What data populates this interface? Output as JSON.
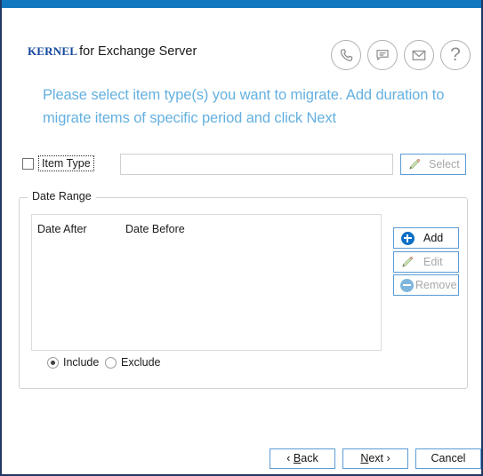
{
  "window": {
    "titlebar_color": "#1178bf",
    "border_color": "#1f3864"
  },
  "header": {
    "brand_mark": "Kernel",
    "brand_suffix": "for Exchange Server",
    "brand_color": "#15489e",
    "icons": [
      {
        "name": "phone-icon",
        "title": "Call support"
      },
      {
        "name": "chat-icon",
        "title": "Live chat"
      },
      {
        "name": "email-icon",
        "title": "Email support"
      },
      {
        "name": "help-icon",
        "title": "Help",
        "glyph": "?"
      }
    ]
  },
  "main": {
    "heading": "Please select item type(s) you want to migrate. Add duration to migrate items of specific period and click Next",
    "heading_color": "#64b0e0",
    "item_type": {
      "checkbox_label": "Item Type",
      "checked": false,
      "input_value": "",
      "input_placeholder": "",
      "select_button": {
        "label": "Select",
        "icon": "pencil-icon",
        "enabled": false
      }
    },
    "date_range": {
      "group_title": "Date Range",
      "columns": [
        "Date After",
        "Date Before"
      ],
      "rows": [],
      "buttons": [
        {
          "name": "add",
          "label": "Add",
          "icon": "circle-plus-icon",
          "enabled": true
        },
        {
          "name": "edit",
          "label": "Edit",
          "icon": "pencil-icon",
          "enabled": false
        },
        {
          "name": "remove",
          "label": "Remove",
          "icon": "circle-minus-icon",
          "enabled": false
        }
      ],
      "scope_options": [
        {
          "value": "include",
          "label": "Include",
          "selected": true
        },
        {
          "value": "exclude",
          "label": "Exclude",
          "selected": false
        }
      ]
    }
  },
  "footer": {
    "back": {
      "prefix": "‹ ",
      "pre": "",
      "acc": "B",
      "post": "ack"
    },
    "next": {
      "pre": "",
      "acc": "N",
      "post": "ext",
      "suffix": " ›"
    },
    "cancel": {
      "label": "Cancel"
    }
  }
}
